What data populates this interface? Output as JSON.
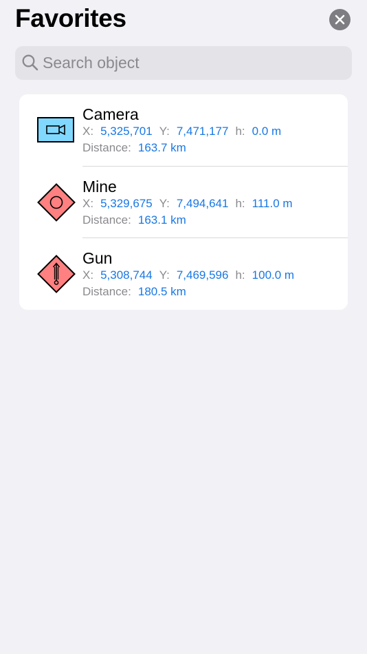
{
  "header": {
    "title": "Favorites"
  },
  "search": {
    "placeholder": "Search object",
    "value": ""
  },
  "favorites": [
    {
      "name": "Camera",
      "icon": "camera-icon",
      "x_label": "X:",
      "x_value": "5,325,701",
      "y_label": "Y:",
      "y_value": "7,471,177",
      "h_label": "h:",
      "h_value": "0.0 m",
      "distance_label": "Distance:",
      "distance_value": "163.7 km"
    },
    {
      "name": "Mine",
      "icon": "mine-icon",
      "x_label": "X:",
      "x_value": "5,329,675",
      "y_label": "Y:",
      "y_value": "7,494,641",
      "h_label": "h:",
      "h_value": "111.0 m",
      "distance_label": "Distance:",
      "distance_value": "163.1 km"
    },
    {
      "name": "Gun",
      "icon": "gun-icon",
      "x_label": "X:",
      "x_value": "5,308,744",
      "y_label": "Y:",
      "y_value": "7,469,596",
      "h_label": "h:",
      "h_value": "100.0 m",
      "distance_label": "Distance:",
      "distance_value": "180.5 km"
    }
  ],
  "colors": {
    "background": "#f2f1f6",
    "value_blue": "#1878e4",
    "camera_fill": "#80d8ff",
    "hostile_fill": "#ff8080"
  }
}
